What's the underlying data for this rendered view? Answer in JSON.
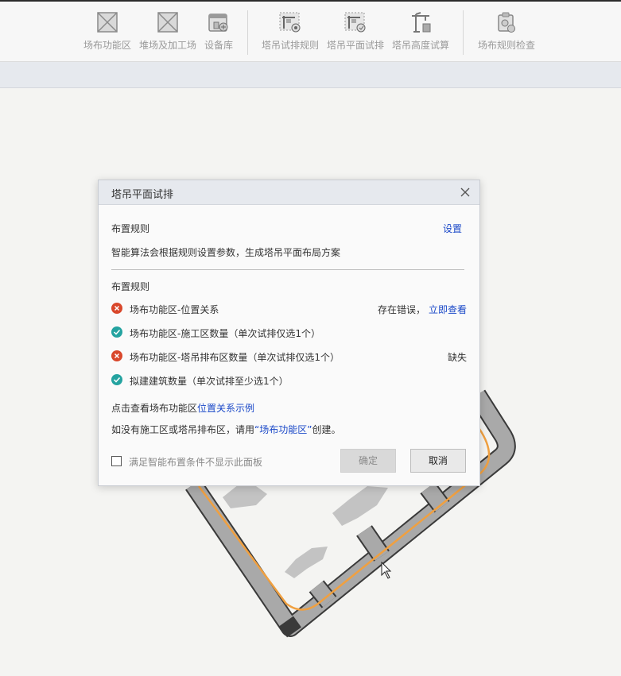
{
  "toolbar": {
    "items": [
      {
        "label": "场布功能区",
        "icon": "placeholder-image-icon"
      },
      {
        "label": "堆场及加工场",
        "icon": "placeholder-image-icon"
      },
      {
        "label": "设备库",
        "icon": "equipment-library-icon"
      },
      {
        "label": "塔吊试排规则",
        "icon": "crane-rule-icon"
      },
      {
        "label": "塔吊平面试排",
        "icon": "crane-plane-icon"
      },
      {
        "label": "塔吊高度试算",
        "icon": "crane-height-icon"
      },
      {
        "label": "场布规则检查",
        "icon": "rule-check-icon"
      }
    ]
  },
  "dialog": {
    "title": "塔吊平面试排",
    "section1_title": "布置规则",
    "settings_link": "设置",
    "description": "智能算法会根据规则设置参数，生成塔吊平面布局方案",
    "section2_title": "布置规则",
    "rules": [
      {
        "status": "error",
        "text": "场布功能区-位置关系",
        "note": "存在错误，",
        "link": "立即查看"
      },
      {
        "status": "ok",
        "text": "场布功能区-施工区数量（单次试排仅选1个）",
        "note": "",
        "link": ""
      },
      {
        "status": "error",
        "text": "场布功能区-塔吊排布区数量（单次试排仅选1个）",
        "note": "缺失",
        "link": ""
      },
      {
        "status": "ok",
        "text": "拟建建筑数量（单次试排至少选1个）",
        "note": "",
        "link": ""
      }
    ],
    "example_prefix": "点击查看场布功能区",
    "example_link": "位置关系示例",
    "hint_prefix": "如没有施工区或塔吊排布区，请用",
    "hint_link": "“场布功能区”",
    "hint_suffix": "创建。",
    "checkbox_label": "满足智能布置条件不显示此面板",
    "ok_button": "确定",
    "cancel_button": "取消"
  },
  "colors": {
    "error": "#d9472b",
    "ok": "#24a3a0",
    "link": "#1a48c8",
    "boundary": "#f0a040"
  }
}
